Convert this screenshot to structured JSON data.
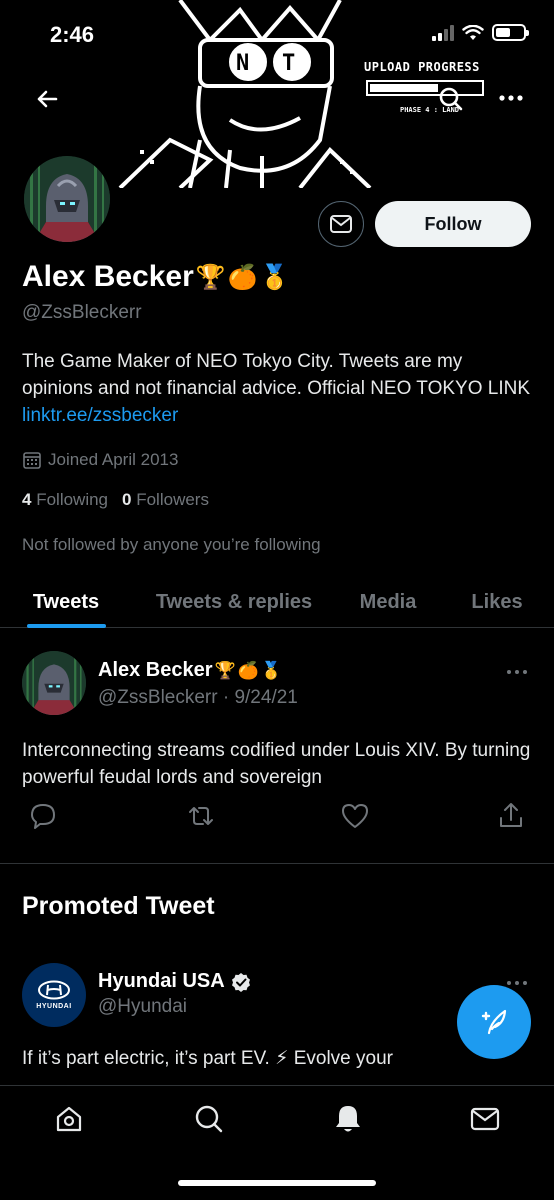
{
  "status_bar": {
    "time": "2:46"
  },
  "banner": {
    "upload_label": "UPLOAD PROGRESS",
    "phase_label": "PHASE 4 : LAND",
    "upload_progress": 0.62
  },
  "profile": {
    "name": "Alex Becker",
    "name_emojis": [
      "🏆",
      "🍊",
      "🥇"
    ],
    "handle": "@ZssBleckerr",
    "bio_text": "The Game Maker of NEO Tokyo City. Tweets are my opinions and not financial advice. Official NEO TOKYO LINK ",
    "bio_link": "linktr.ee/zssbecker",
    "joined": "Joined April 2013",
    "following_count": "4",
    "following_label": "Following",
    "followers_count": "0",
    "followers_label": "Followers",
    "not_followed": "Not followed by anyone you’re following",
    "follow_label": "Follow"
  },
  "tabs": [
    {
      "label": "Tweets",
      "active": true
    },
    {
      "label": "Tweets & replies",
      "active": false
    },
    {
      "label": "Media",
      "active": false
    },
    {
      "label": "Likes",
      "active": false
    }
  ],
  "tweet": {
    "author": "Alex Becker",
    "handle_date": "@ZssBleckerr · 9/24/21",
    "text": "Interconnecting streams codified under Louis XIV. By turning powerful feudal lords and sovereign"
  },
  "promoted": {
    "title": "Promoted Tweet",
    "advertiser": "Hyundai USA",
    "handle": "@Hyundai",
    "logo_text": "HYUNDAI",
    "text": "If it’s part electric, it’s part EV. ⚡ Evolve your"
  },
  "colors": {
    "accent": "#1d9bf0",
    "background": "#000000",
    "muted": "#71767b",
    "hyundai_blue": "#002c5f"
  },
  "icons": {
    "back": "arrow-left-icon",
    "search": "search-icon",
    "more": "more-horizontal-icon",
    "message": "envelope-icon",
    "calendar": "calendar-icon",
    "reply": "reply-icon",
    "retweet": "retweet-icon",
    "like": "heart-icon",
    "share": "share-icon",
    "compose": "compose-feather-icon",
    "nav": [
      "home-icon",
      "search-icon",
      "bell-icon",
      "mail-icon"
    ]
  }
}
